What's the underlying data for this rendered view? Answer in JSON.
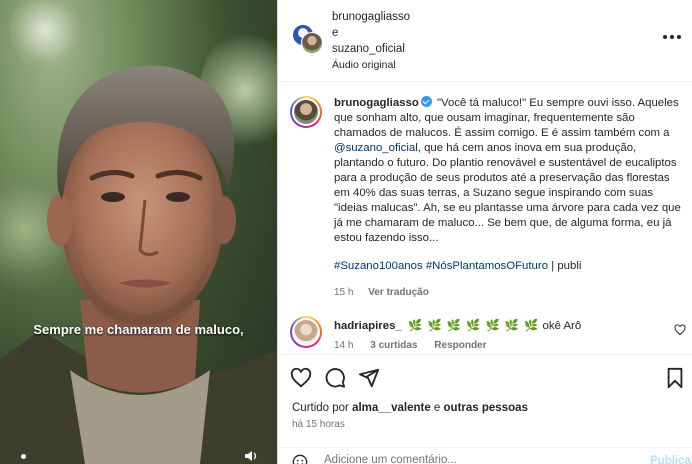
{
  "video": {
    "subtitle": "Sempre me chamaram de maluco,",
    "icons": {
      "mute": "speaker-mute-icon"
    }
  },
  "header": {
    "author": "brunogagliasso",
    "joiner": "e",
    "coauthor": "suzano_oficial",
    "audio": "Áudio original",
    "more_icon": "more-options-icon"
  },
  "post": {
    "username": "brunogagliasso",
    "text_1": " \"Você tá maluco!\" Eu sempre ouvi isso. Aqueles que sonham alto, que ousam imaginar, frequentemente são chamados de malucos. É assim comigo. E é assim também com a ",
    "mention": "@suzano_oficial",
    "text_2": ", que há cem anos inova em sua produção, plantando o futuro. Do plantio renovável e sustentável de eucaliptos para a produção de seus produtos até a preservação das florestas em 40% das suas terras, a Suzano segue inspirando com suas \"ideias malucas\". Ah, se eu plantasse uma árvore para cada vez que já me chamaram de maluco... Se bem que, de alguma forma, eu já estou fazendo isso...",
    "hashtags": "#Suzano100anos #NósPlantamosOFuturo",
    "tag_suffix": " | publi",
    "age": "15 h",
    "translate": "Ver tradução"
  },
  "comment": {
    "username": "hadriapires_",
    "emojis": "🌿 🌿 🌿 🌿 🌿 🌿 🌿",
    "text": " okê Arô",
    "age": "14 h",
    "likes": "3 curtidas",
    "reply": "Responder"
  },
  "actions": {
    "liked_prefix": "Curtido por ",
    "liked_user": "alma__valente",
    "liked_suffix": " e ",
    "liked_others": "outras pessoas",
    "time": "há 15 horas",
    "comment_placeholder": "Adicione um comentário...",
    "publish": "Publicar",
    "icons": [
      "heart-icon",
      "comment-icon",
      "share-icon",
      "bookmark-icon"
    ]
  },
  "colors": {
    "link": "#00376b",
    "verified": "#3897f0",
    "muted": "#737373",
    "publish_disabled": "#b2dffc"
  }
}
